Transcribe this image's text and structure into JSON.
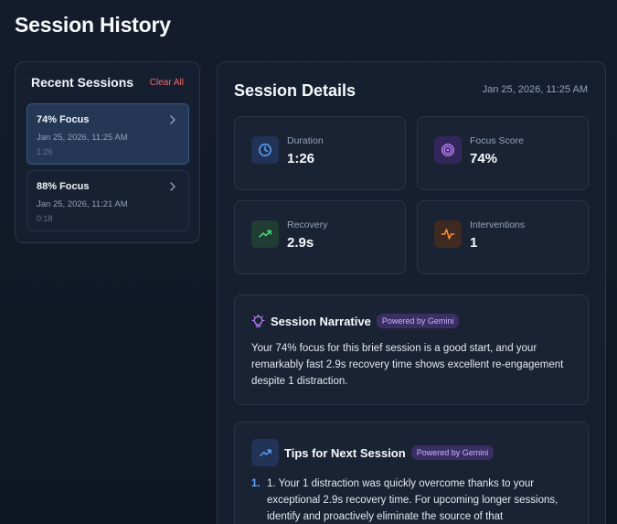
{
  "page": {
    "title": "Session History"
  },
  "sidebar": {
    "title": "Recent Sessions",
    "clear_label": "Clear All",
    "sessions": [
      {
        "title": "74% Focus",
        "date": "Jan 25, 2026, 11:25 AM",
        "duration": "1:26",
        "active": true
      },
      {
        "title": "88% Focus",
        "date": "Jan 25, 2026, 11:21 AM",
        "duration": "0:18",
        "active": false
      }
    ]
  },
  "details": {
    "title": "Session Details",
    "date": "Jan 25, 2026, 11:25 AM",
    "stats": [
      {
        "label": "Duration",
        "value": "1:26",
        "icon": "clock-icon",
        "color": "#60a5fa"
      },
      {
        "label": "Focus Score",
        "value": "74%",
        "icon": "target-icon",
        "color": "#c084fc"
      },
      {
        "label": "Recovery",
        "value": "2.9s",
        "icon": "trend-up-icon",
        "color": "#4ade80"
      },
      {
        "label": "Interventions",
        "value": "1",
        "icon": "activity-icon",
        "color": "#fb923c"
      }
    ],
    "narrative": {
      "title": "Session Narrative",
      "badge": "Powered by Gemini",
      "text": "Your 74% focus for this brief session is a good start, and your remarkably fast 2.9s recovery time shows excellent re-engagement despite 1 distraction."
    },
    "tips": {
      "title": "Tips for Next Session",
      "badge": "Powered by Gemini",
      "items": [
        {
          "number": "1.",
          "text": "1. Your 1 distraction was quickly overcome thanks to your exceptional 2.9s recovery time. For upcoming longer sessions, identify and proactively eliminate the source of that"
        }
      ]
    }
  }
}
